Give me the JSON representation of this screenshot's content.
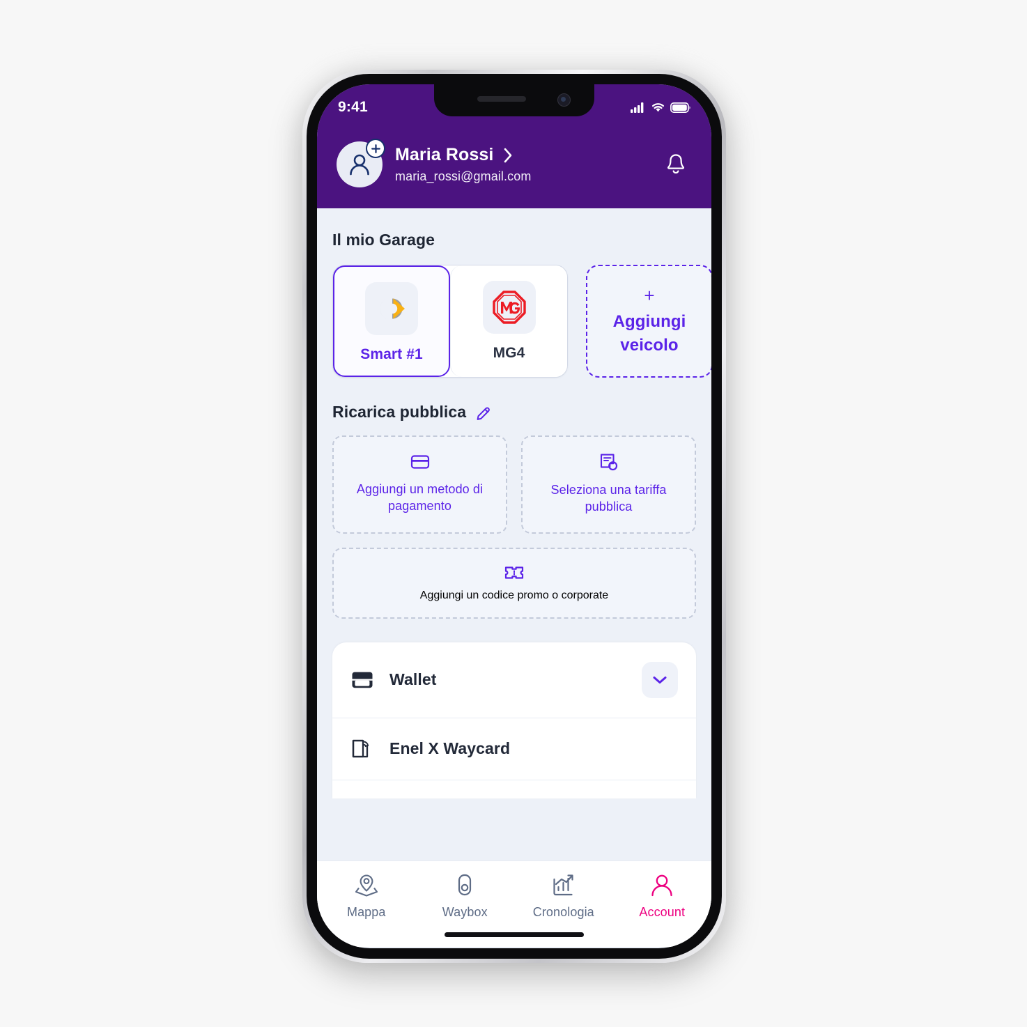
{
  "statusbar": {
    "time": "9:41",
    "signal_icon": "cellular-signal-icon",
    "wifi_icon": "wifi-icon",
    "battery_icon": "battery-icon"
  },
  "header": {
    "user_name": "Maria Rossi",
    "user_email": "maria_rossi@gmail.com",
    "chevron": "›",
    "avatar_icon": "user-avatar-icon",
    "avatar_badge_icon": "plus-badge-icon",
    "bell_icon": "notification-bell-icon",
    "background_color": "#4B1380"
  },
  "garage": {
    "title": "Il mio Garage",
    "vehicles": [
      {
        "label": "Smart #1",
        "logo": "smart-logo-icon",
        "selected": true
      },
      {
        "label": "MG4",
        "logo": "mg-logo-icon",
        "selected": false
      }
    ],
    "add_vehicle": {
      "plus": "+",
      "label": "Aggiungi\nveicolo",
      "line1": "Aggiungi",
      "line2": "veicolo"
    }
  },
  "public_charging": {
    "title": "Ricarica pubblica",
    "edit_icon": "pencil-edit-icon",
    "cards": [
      {
        "icon": "credit-card-icon",
        "label": "Aggiungi un metodo di pagamento"
      },
      {
        "icon": "tariff-document-icon",
        "label": "Seleziona una tariffa pubblica"
      }
    ],
    "promo_card": {
      "icon": "ticket-icon",
      "label": "Aggiungi un codice promo o corporate"
    }
  },
  "account_list": {
    "items": [
      {
        "label": "Wallet",
        "icon": "wallet-icon",
        "has_chevron": true,
        "chevron_icon": "chevron-down-icon"
      },
      {
        "label": "Enel X Waycard",
        "icon": "waycard-nfc-icon",
        "has_chevron": false
      }
    ]
  },
  "tabbar": {
    "items": [
      {
        "label": "Mappa",
        "icon": "map-pin-icon",
        "active": false
      },
      {
        "label": "Waybox",
        "icon": "waybox-charger-icon",
        "active": false
      },
      {
        "label": "Cronologia",
        "icon": "history-chart-icon",
        "active": false
      },
      {
        "label": "Account",
        "icon": "account-person-icon",
        "active": true
      }
    ],
    "active_color": "#ED0080",
    "inactive_color": "#5E6C86"
  },
  "theme": {
    "purple": "#4B1380",
    "accent_violet": "#5B23E8",
    "background": "#EDF1F8",
    "pink": "#ED0080"
  }
}
